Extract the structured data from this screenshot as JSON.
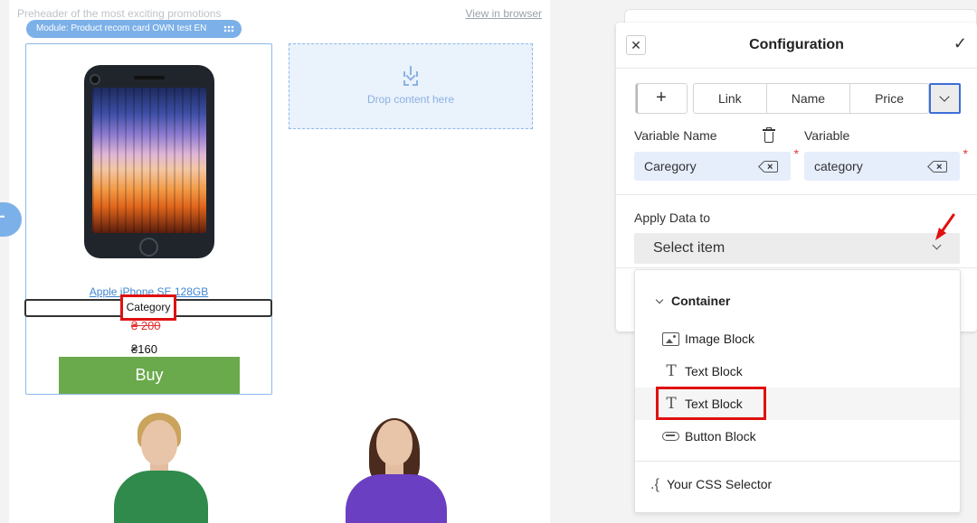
{
  "email": {
    "preheader": "Preheader of the most exciting promotions",
    "view_in_browser": "View in browser",
    "module_label": "Module: Product recom card OWN test EN",
    "product": {
      "name": "Apple iPhone SE 128GB",
      "category": "Category",
      "old_price": "₴ 200",
      "new_price": "₴160",
      "buy_label": "Buy"
    },
    "drop_zone": "Drop content here"
  },
  "config": {
    "title": "Configuration",
    "close_icon": "close-icon",
    "confirm_icon": "check-icon",
    "add_label": "+",
    "tabs": [
      "Link",
      "Name",
      "Price"
    ],
    "variable_name_label": "Variable Name",
    "variable_label": "Variable",
    "variable_name_value": "Caregory",
    "variable_value": "category",
    "apply_data_label": "Apply Data to",
    "select_placeholder": "Select item",
    "dropdown": {
      "group": "Container",
      "items": [
        {
          "label": "Image Block",
          "icon": "image-icon"
        },
        {
          "label": "Text Block",
          "icon": "text-icon"
        },
        {
          "label": "Text Block",
          "icon": "text-icon",
          "highlighted": true
        },
        {
          "label": "Button Block",
          "icon": "button-icon"
        }
      ],
      "css_selector": "Your CSS Selector"
    }
  },
  "colors": {
    "accent": "#3c6fd8",
    "module_chip": "#7cb0e8",
    "buy_button": "#6aaa4c",
    "annotation_red": "#e01010",
    "link_blue": "#3f86d1"
  }
}
